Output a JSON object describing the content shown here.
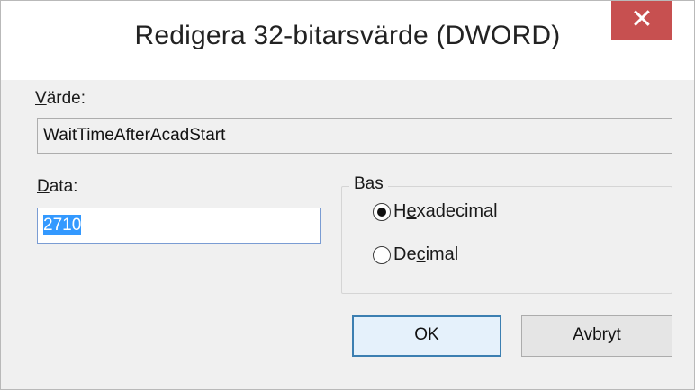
{
  "window": {
    "title": "Redigera 32-bitarsvärde (DWORD)",
    "close_glyph": "✕"
  },
  "value_name": {
    "label_mnemonic": "V",
    "label_rest": "ärde:",
    "value": "WaitTimeAfterAcadStart"
  },
  "value_data": {
    "label_mnemonic": "D",
    "label_rest": "ata:",
    "value": "2710"
  },
  "base": {
    "title": "Bas",
    "options": [
      {
        "pre": "H",
        "mnemonic": "e",
        "post": "xadecimal",
        "checked": true
      },
      {
        "pre": "De",
        "mnemonic": "c",
        "post": "imal",
        "checked": false
      }
    ]
  },
  "buttons": {
    "ok_label": "OK",
    "cancel_label": "Avbryt"
  },
  "colors": {
    "close_button": "#c75050",
    "selection": "#3399ff",
    "default_button_border": "#3c7fb1"
  }
}
